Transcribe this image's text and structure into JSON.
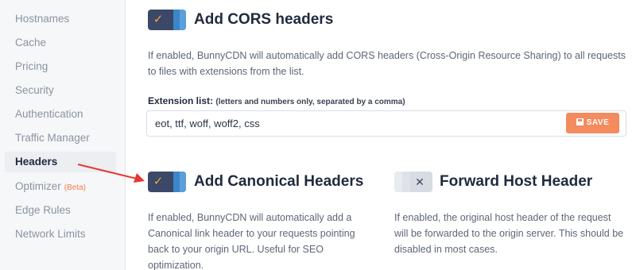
{
  "sidebar": {
    "items": [
      {
        "label": "Hostnames"
      },
      {
        "label": "Cache"
      },
      {
        "label": "Pricing"
      },
      {
        "label": "Security"
      },
      {
        "label": "Authentication"
      },
      {
        "label": "Traffic Manager"
      },
      {
        "label": "Headers",
        "active": true
      },
      {
        "label": "Optimizer",
        "badge": "(Beta)"
      },
      {
        "label": "Edge Rules"
      },
      {
        "label": "Network Limits"
      }
    ]
  },
  "cors": {
    "enabled": true,
    "title": "Add CORS headers",
    "description": "If enabled, BunnyCDN will automatically add CORS headers (Cross-Origin Resource Sharing) to all requests to files with extensions from the list.",
    "field_label": "Extension list:",
    "field_hint": "(letters and numbers only, separated by a comma)",
    "field_value": "eot, ttf, woff, woff2, css",
    "save_label": "SAVE"
  },
  "canonical": {
    "enabled": true,
    "title": "Add Canonical Headers",
    "description": "If enabled, BunnyCDN will automatically add a Canonical link header to your requests pointing back to your origin URL. Useful for SEO optimization."
  },
  "forward_host": {
    "enabled": false,
    "title": "Forward Host Header",
    "description": "If enabled, the original host header of the request will be forwarded to the origin server. This should be disabled in most cases."
  },
  "toggle_icons": {
    "on": "checkmark-icon",
    "off": "x-icon"
  },
  "colors": {
    "accent": "#f38b5f",
    "toggle_on": "#3b4868",
    "toggle_stripe": "#3b86c9",
    "arrow": "#e53935"
  }
}
